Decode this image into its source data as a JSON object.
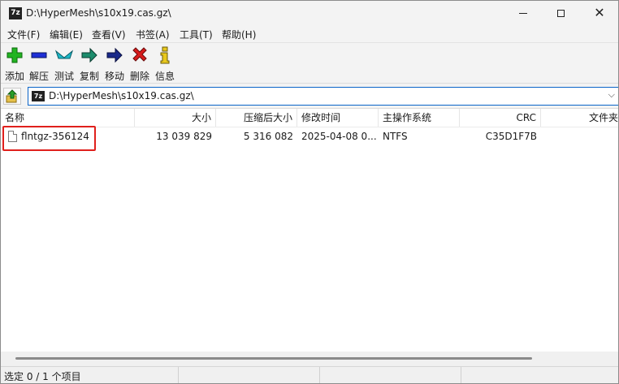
{
  "window": {
    "title": "D:\\HyperMesh\\s10x19.cas.gz\\",
    "app_icon_text": "7z"
  },
  "menu": [
    {
      "label": "文件(F)"
    },
    {
      "label": "编辑(E)"
    },
    {
      "label": "查看(V)"
    },
    {
      "label": "书签(A)"
    },
    {
      "label": "工具(T)"
    },
    {
      "label": "帮助(H)"
    }
  ],
  "toolbar": [
    {
      "label": "添加",
      "icon": "add-icon",
      "color": "#22b422"
    },
    {
      "label": "解压",
      "icon": "extract-icon",
      "color": "#1e2fd6"
    },
    {
      "label": "测试",
      "icon": "test-icon",
      "color": "#1cb8c8"
    },
    {
      "label": "复制",
      "icon": "copy-icon",
      "color": "#1c8c6c"
    },
    {
      "label": "移动",
      "icon": "move-icon",
      "color": "#1a2a8a"
    },
    {
      "label": "删除",
      "icon": "delete-icon",
      "color": "#d81c1c"
    },
    {
      "label": "信息",
      "icon": "info-icon",
      "color": "#e8c81c"
    }
  ],
  "address": {
    "value": "D:\\HyperMesh\\s10x19.cas.gz\\",
    "icon_text": "7z"
  },
  "columns": [
    "名称",
    "大小",
    "压缩后大小",
    "修改时间",
    "主操作系统",
    "CRC",
    "文件夹"
  ],
  "rows": [
    {
      "name": "flntgz-356124",
      "size": "13 039 829",
      "packed": "5 316 082",
      "modified": "2025-04-08 0...",
      "host_os": "NTFS",
      "crc": "C35D1F7B"
    }
  ],
  "status": {
    "text": "选定 0 / 1 个项目"
  },
  "colors": {
    "highlight": "#e0201c",
    "accent": "#0a64c8"
  }
}
